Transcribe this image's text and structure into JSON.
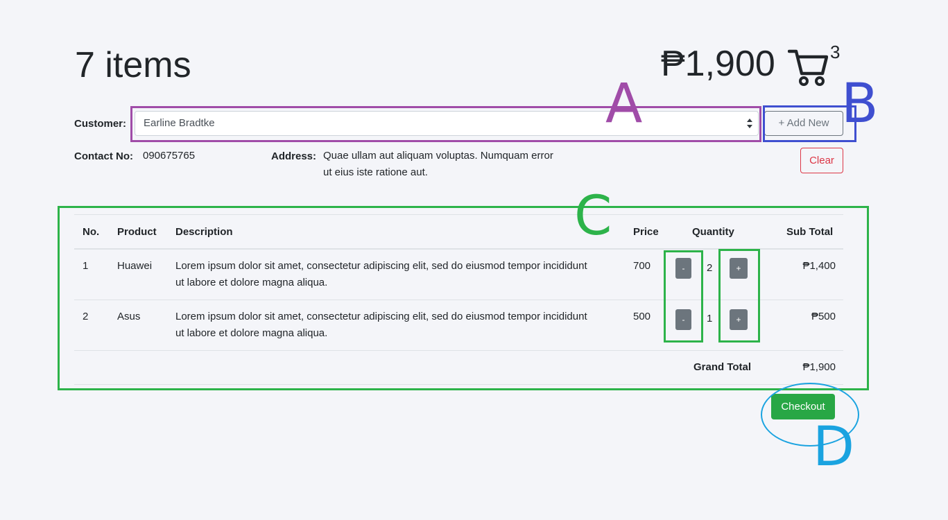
{
  "header": {
    "items_count": "7 items",
    "total": "₱1,900",
    "cart_badge": "3"
  },
  "customer": {
    "label": "Customer:",
    "selected": "Earline Bradtke",
    "add_new_label": "+  Add New",
    "clear_label": "Clear",
    "contact_label": "Contact No:",
    "contact_value": "090675765",
    "address_label": "Address:",
    "address_value": "Quae ullam aut aliquam voluptas. Numquam error ut eius iste ratione aut."
  },
  "table": {
    "headers": {
      "no": "No.",
      "product": "Product",
      "description": "Description",
      "price": "Price",
      "quantity": "Quantity",
      "subtotal": "Sub Total"
    },
    "rows": [
      {
        "no": "1",
        "product": "Huawei",
        "description": "Lorem ipsum dolor sit amet, consectetur adipiscing elit, sed do eiusmod tempor incididunt ut labore et dolore magna aliqua.",
        "price": "700",
        "qty": "2",
        "minus": "-",
        "plus": "+",
        "subtotal": "₱1,400"
      },
      {
        "no": "2",
        "product": "Asus",
        "description": "Lorem ipsum dolor sit amet, consectetur adipiscing elit, sed do eiusmod tempor incididunt ut labore et dolore magna aliqua.",
        "price": "500",
        "qty": "1",
        "minus": "-",
        "plus": "+",
        "subtotal": "₱500"
      }
    ],
    "grand_total_label": "Grand Total",
    "grand_total_value": "₱1,900"
  },
  "checkout_label": "Checkout",
  "annotations": {
    "a": "A",
    "b": "B",
    "c": "C",
    "d": "D"
  },
  "colors": {
    "annotation_a": "#a04ca8",
    "annotation_b": "#3f4fd0",
    "annotation_c": "#2db34a",
    "annotation_d": "#1aa3e0",
    "checkout": "#28a745",
    "clear": "#dc3545",
    "secondary": "#6c757d"
  },
  "icons": [
    "cart-icon",
    "select-caret-icon",
    "plus-icon"
  ]
}
